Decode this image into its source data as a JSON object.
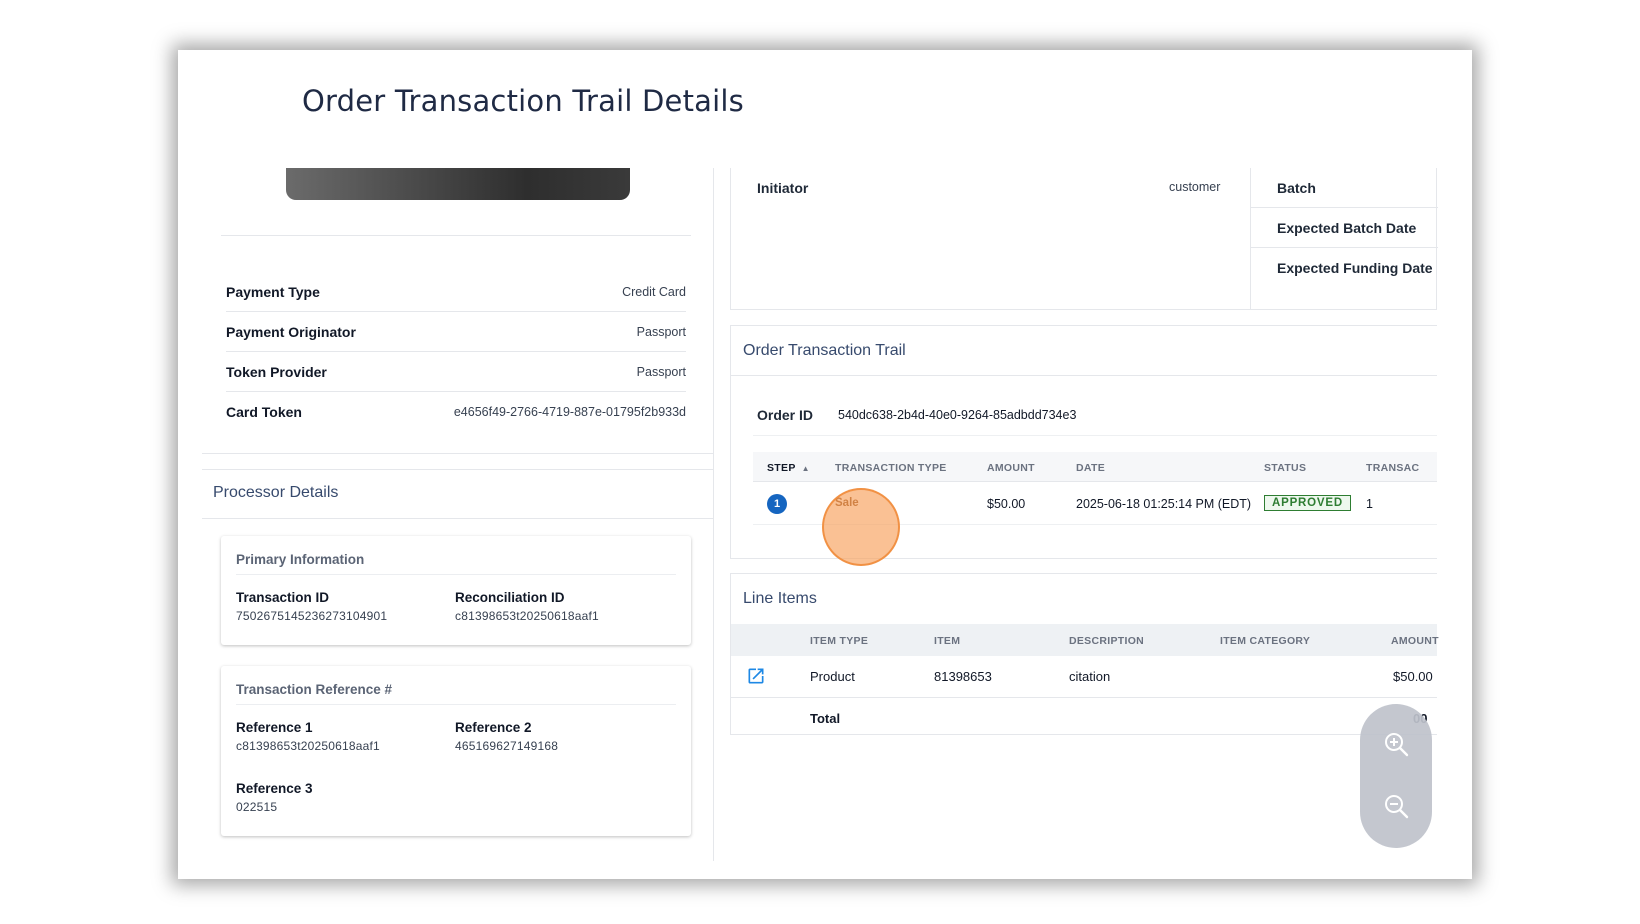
{
  "page": {
    "title": "Order Transaction Trail Details"
  },
  "payment": {
    "rows": [
      {
        "key": "Payment Type",
        "value": "Credit Card"
      },
      {
        "key": "Payment Originator",
        "value": "Passport"
      },
      {
        "key": "Token Provider",
        "value": "Passport"
      },
      {
        "key": "Card Token",
        "value": "e4656f49-2766-4719-887e-01795f2b933d"
      }
    ]
  },
  "processor": {
    "title": "Processor Details",
    "primary": {
      "title": "Primary Information",
      "transaction_id_label": "Transaction ID",
      "transaction_id": "7502675145236273104901",
      "reconciliation_id_label": "Reconciliation ID",
      "reconciliation_id": "c81398653t20250618aaf1"
    },
    "reference": {
      "title": "Transaction Reference #",
      "ref1_label": "Reference 1",
      "ref1": "c81398653t20250618aaf1",
      "ref2_label": "Reference 2",
      "ref2": "465169627149168",
      "ref3_label": "Reference 3",
      "ref3": "022515"
    }
  },
  "summary": {
    "initiator_label": "Initiator",
    "initiator": "customer",
    "batch_labels": [
      "Batch",
      "Expected Batch Date",
      "Expected Funding Date"
    ]
  },
  "trail": {
    "title": "Order Transaction Trail",
    "order_id_label": "Order ID",
    "order_id": "540dc638-2b4d-40e0-9264-85adbdd734e3",
    "columns": {
      "step": "STEP",
      "type": "TRANSACTION TYPE",
      "amount": "AMOUNT",
      "date": "DATE",
      "status": "STATUS",
      "transaction": "TRANSAC"
    },
    "row": {
      "step": "1",
      "type": "Sale",
      "amount": "$50.00",
      "date": "2025-06-18 01:25:14 PM (EDT)",
      "status": "APPROVED",
      "transaction": "1"
    }
  },
  "line_items": {
    "title": "Line Items",
    "columns": {
      "item_type": "ITEM TYPE",
      "item": "ITEM",
      "description": "DESCRIPTION",
      "item_category": "ITEM CATEGORY",
      "amount": "AMOUNT"
    },
    "row": {
      "item_type": "Product",
      "item": "81398653",
      "description": "citation",
      "item_category": "",
      "amount": "$50.00"
    },
    "total_label": "Total",
    "total_visible": "00"
  },
  "colors": {
    "accent": "#1565c0",
    "approved": "#2e7d32",
    "click_marker": "#f7a05a"
  },
  "icons": [
    "open-in-new-icon",
    "zoom-in-icon",
    "zoom-out-icon",
    "sort-asc-icon"
  ]
}
